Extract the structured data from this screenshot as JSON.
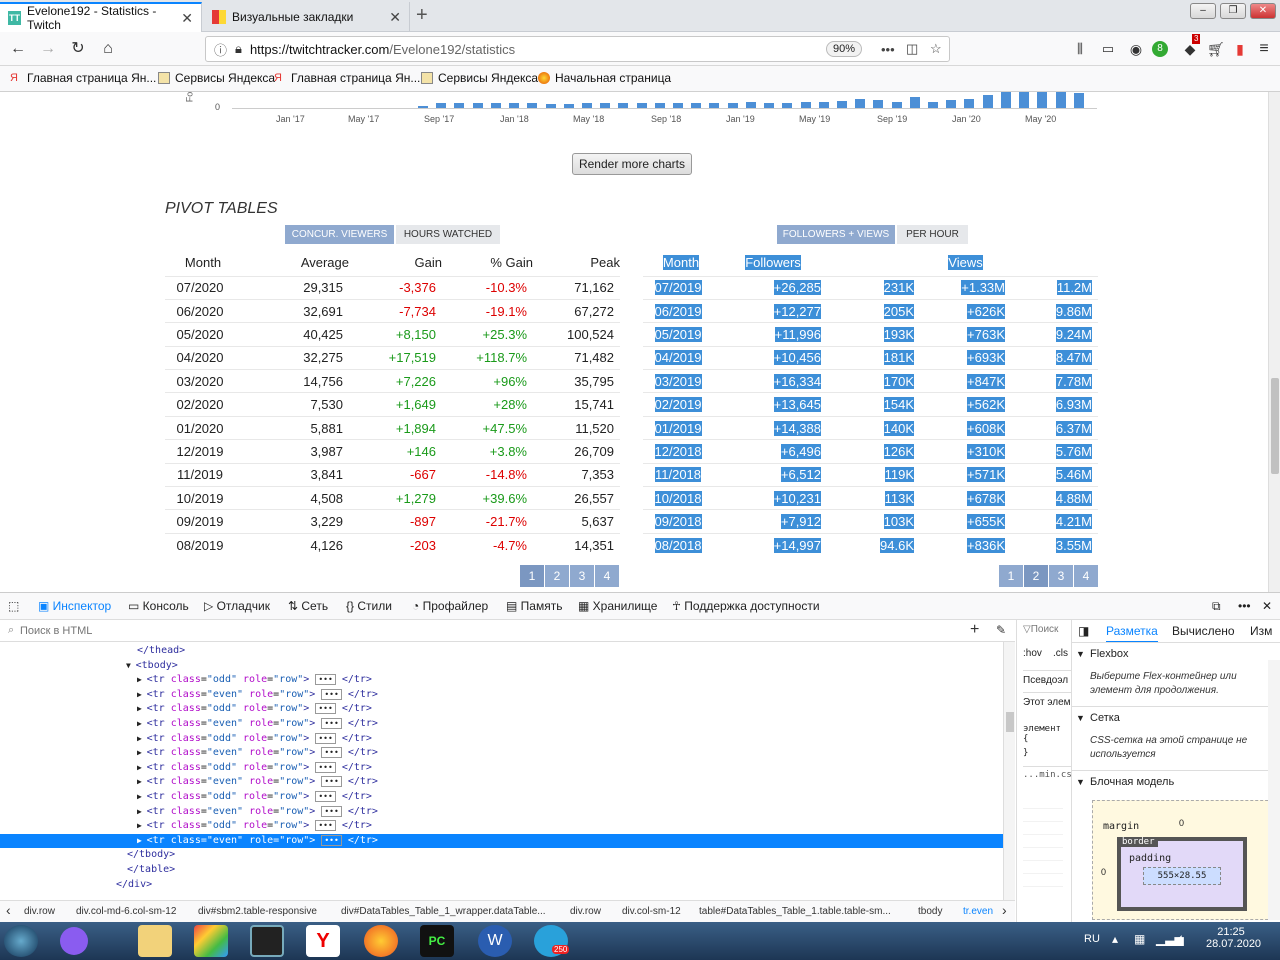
{
  "browser": {
    "tabs": [
      {
        "title": "Evelone192 - Statistics - Twitch"
      },
      {
        "title": "Визуальные закладки"
      }
    ],
    "url_host": "https://twitchtracker.com",
    "url_path": "/Evelone192/statistics",
    "zoom": "90%",
    "badge_count": "3",
    "bookmarks": [
      "Главная страница Ян...",
      "Сервисы Яндекса",
      "Главная страница Ян...",
      "Сервисы Яндекса",
      "Начальная страница"
    ]
  },
  "chart": {
    "x_ticks": [
      "Jan '17",
      "May '17",
      "Sep '17",
      "Jan '18",
      "May '18",
      "Sep '18",
      "Jan '19",
      "May '19",
      "Sep '19",
      "Jan '20",
      "May '20"
    ],
    "y_zero": "0",
    "bar_heights": [
      0.02,
      0.05,
      0.05,
      0.05,
      0.05,
      0.06,
      0.05,
      0.04,
      0.04,
      0.05,
      0.05,
      0.06,
      0.06,
      0.06,
      0.05,
      0.05,
      0.06,
      0.06,
      0.07,
      0.06,
      0.06,
      0.07,
      0.07,
      0.08,
      0.1,
      0.09,
      0.07,
      0.12,
      0.07,
      0.09,
      0.1,
      0.14,
      0.18,
      0.18,
      0.18,
      0.18,
      0.17
    ]
  },
  "render_more": "Render more charts",
  "pivot": {
    "title": "PIVOT TABLES",
    "left_buttons": [
      "CONCUR. VIEWERS",
      "HOURS WATCHED"
    ],
    "right_buttons": [
      "FOLLOWERS + VIEWS",
      "PER HOUR"
    ],
    "left_headers": [
      "Month",
      "Average",
      "Gain",
      "% Gain",
      "Peak"
    ],
    "right_headers": [
      "Month",
      "Followers",
      "",
      "Views",
      ""
    ],
    "left_rows": [
      [
        "07/2020",
        "29,315",
        "-3,376",
        "-10.3%",
        "71,162"
      ],
      [
        "06/2020",
        "32,691",
        "-7,734",
        "-19.1%",
        "67,272"
      ],
      [
        "05/2020",
        "40,425",
        "+8,150",
        "+25.3%",
        "100,524"
      ],
      [
        "04/2020",
        "32,275",
        "+17,519",
        "+118.7%",
        "71,482"
      ],
      [
        "03/2020",
        "14,756",
        "+7,226",
        "+96%",
        "35,795"
      ],
      [
        "02/2020",
        "7,530",
        "+1,649",
        "+28%",
        "15,741"
      ],
      [
        "01/2020",
        "5,881",
        "+1,894",
        "+47.5%",
        "11,520"
      ],
      [
        "12/2019",
        "3,987",
        "+146",
        "+3.8%",
        "26,709"
      ],
      [
        "11/2019",
        "3,841",
        "-667",
        "-14.8%",
        "7,353"
      ],
      [
        "10/2019",
        "4,508",
        "+1,279",
        "+39.6%",
        "26,557"
      ],
      [
        "09/2019",
        "3,229",
        "-897",
        "-21.7%",
        "5,637"
      ],
      [
        "08/2019",
        "4,126",
        "-203",
        "-4.7%",
        "14,351"
      ]
    ],
    "right_rows": [
      [
        "07/2019",
        "+26,285",
        "231K",
        "+1.33M",
        "11.2M"
      ],
      [
        "06/2019",
        "+12,277",
        "205K",
        "+626K",
        "9.86M"
      ],
      [
        "05/2019",
        "+11,996",
        "193K",
        "+763K",
        "9.24M"
      ],
      [
        "04/2019",
        "+10,456",
        "181K",
        "+693K",
        "8.47M"
      ],
      [
        "03/2019",
        "+16,334",
        "170K",
        "+847K",
        "7.78M"
      ],
      [
        "02/2019",
        "+13,645",
        "154K",
        "+562K",
        "6.93M"
      ],
      [
        "01/2019",
        "+14,388",
        "140K",
        "+608K",
        "6.37M"
      ],
      [
        "12/2018",
        "+6,496",
        "126K",
        "+310K",
        "5.76M"
      ],
      [
        "11/2018",
        "+6,512",
        "119K",
        "+571K",
        "5.46M"
      ],
      [
        "10/2018",
        "+10,231",
        "113K",
        "+678K",
        "4.88M"
      ],
      [
        "09/2018",
        "+7,912",
        "103K",
        "+655K",
        "4.21M"
      ],
      [
        "08/2018",
        "+14,997",
        "94.6K",
        "+836K",
        "3.55M"
      ]
    ],
    "pages": [
      "1",
      "2",
      "3",
      "4"
    ]
  },
  "devtools": {
    "tabs": [
      "Инспектор",
      "Консоль",
      "Отладчик",
      "Сеть",
      "Стили",
      "Профайлер",
      "Память",
      "Хранилище",
      "Поддержка доступности"
    ],
    "search_placeholder": "Поиск в HTML",
    "tree_open": [
      "</thead>",
      "<tbody>"
    ],
    "tree_close": [
      "</tbody>",
      "</table>",
      "</div>"
    ],
    "rows": [
      "odd",
      "even",
      "odd",
      "even",
      "odd",
      "even",
      "odd",
      "even",
      "odd",
      "even",
      "odd",
      "even"
    ],
    "breadcrumbs": [
      "div.row",
      "div.col-md-6.col-sm-12",
      "div#sbm2.table-responsive",
      "div#DataTables_Table_1_wrapper.dataTable...",
      "div.row",
      "div.col-sm-12",
      "table#DataTables_Table_1.table.table-sm...",
      "tbody",
      "tr.even"
    ],
    "rules_items": [
      "Поиск",
      ":hov",
      ".cls",
      "Псевдоэл",
      "Этот элем",
      "элемент {",
      "}",
      "...min.cs"
    ],
    "layout_tabs": [
      "Разметка",
      "Вычислено",
      "Изм"
    ],
    "sections": [
      "Flexbox",
      "Сетка",
      "Блочная модель"
    ],
    "flex_note": "Выберите Flex-контейнер или элемент для продолжения.",
    "grid_note": "CSS-сетка на этой странице не используется",
    "box": {
      "margin": "margin",
      "border": "border",
      "padding": "padding",
      "size": "555×28.55",
      "zero": "0"
    }
  },
  "taskbar": {
    "lang": "RU",
    "time": "21:25",
    "date": "28.07.2020",
    "telegram_badge": "250"
  }
}
